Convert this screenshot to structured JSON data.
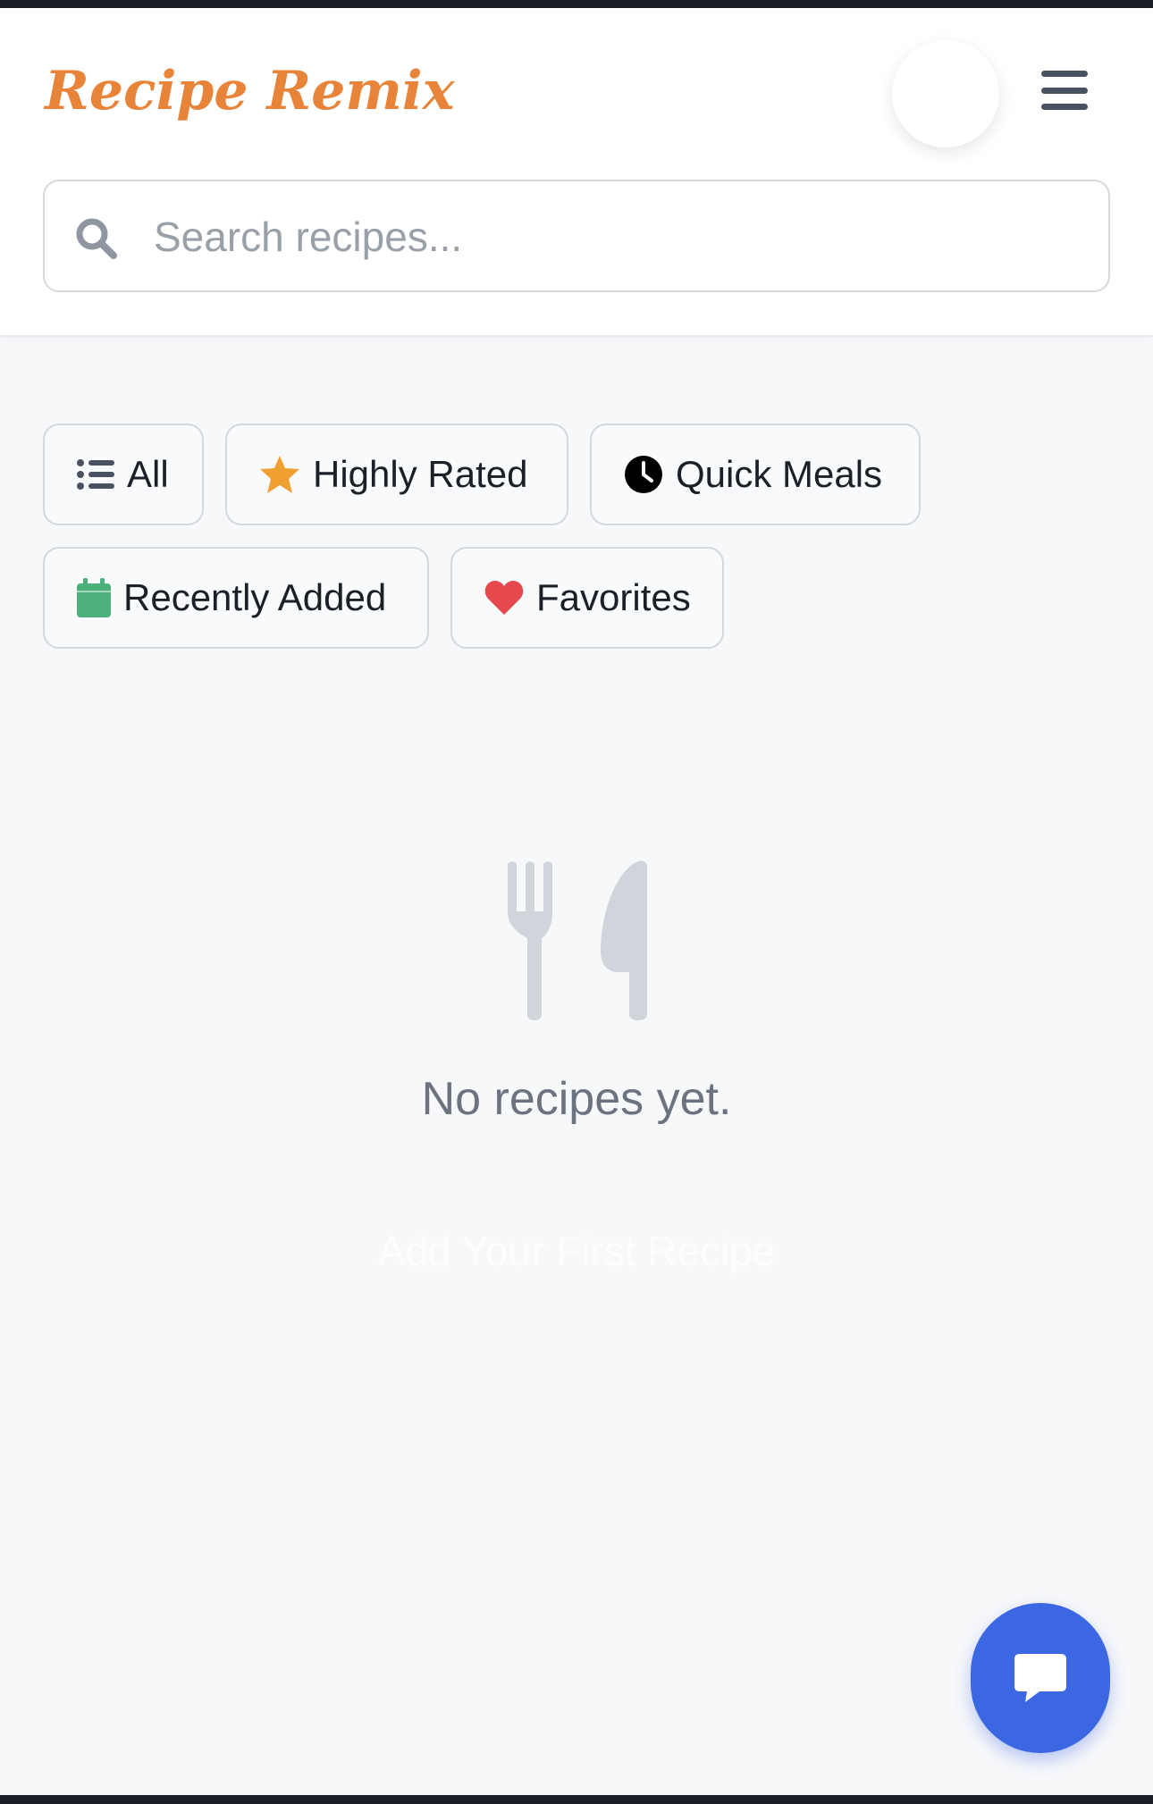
{
  "app": {
    "brand": "Recipe Remix"
  },
  "header": {
    "avatar": "",
    "menu_icon": "hamburger-menu-icon"
  },
  "search": {
    "placeholder": "Search recipes...",
    "value": "",
    "icon": "search-icon"
  },
  "filters": [
    {
      "label": "All",
      "icon": "list-icon"
    },
    {
      "label": "Highly Rated",
      "icon": "star-icon"
    },
    {
      "label": "Quick Meals",
      "icon": "clock-icon"
    },
    {
      "label": "Recently Added",
      "icon": "calendar-icon"
    },
    {
      "label": "Favorites",
      "icon": "heart-icon"
    }
  ],
  "empty_state": {
    "icon": "utensils-icon",
    "message": "No recipes yet.",
    "action_label": "Add Your First Recipe"
  },
  "fab": {
    "icon": "chat-bubble-icon"
  },
  "colors": {
    "brand": "#e8843a",
    "star": "#f0a030",
    "calendar": "#4cb07a",
    "heart": "#e5484d",
    "fab": "#3c67e3",
    "empty_icon": "#d1d5db"
  }
}
